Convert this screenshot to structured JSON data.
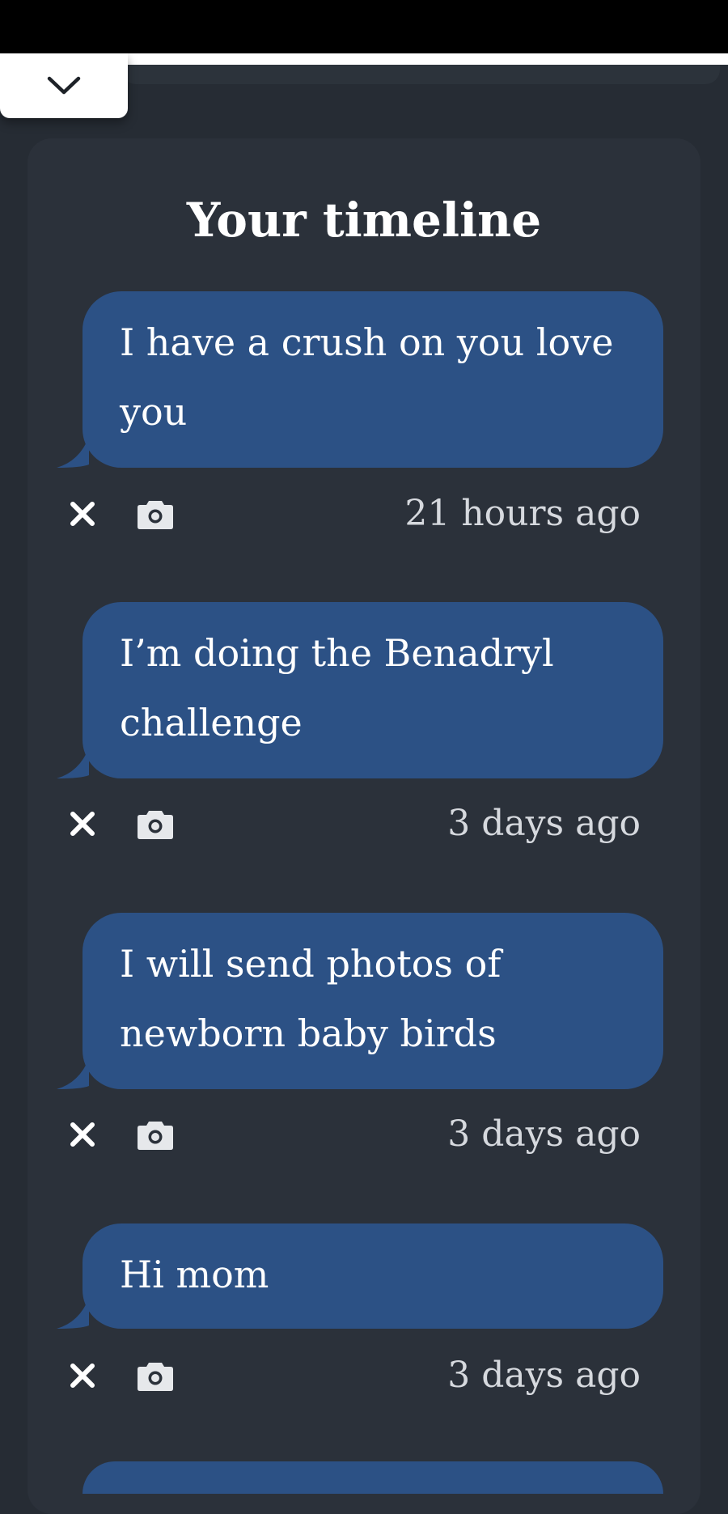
{
  "header": {
    "collapse_icon": "chevron-down-icon"
  },
  "timeline": {
    "title": "Your timeline",
    "entries": [
      {
        "text": "I have a crush on you love you",
        "time": "21 hours ago"
      },
      {
        "text": "I’m doing the Benadryl challenge",
        "time": "3 days ago"
      },
      {
        "text": "I will send photos of newborn baby birds",
        "time": "3 days ago"
      },
      {
        "text": "Hi mom",
        "time": "3 days ago"
      }
    ],
    "delete_icon": "close-icon",
    "photo_icon": "camera-icon"
  },
  "colors": {
    "background": "#262c34",
    "panel": "#2b313a",
    "bubble": "#2c5185",
    "timestamp": "#d6d9de"
  }
}
